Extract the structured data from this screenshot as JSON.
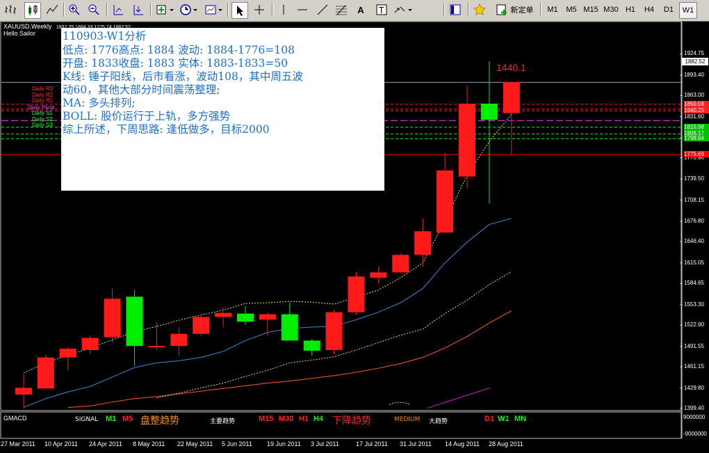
{
  "toolbar": {
    "new_order_label": "新定单",
    "timeframes": [
      "M1",
      "M5",
      "M15",
      "M30",
      "H1",
      "H4",
      "D1",
      "W1"
    ],
    "active_timeframe": "W1"
  },
  "chart_header": {
    "symbol_line": "XAUUSD,Weekly",
    "ohlc_line": "1837.25 1884.33 1775.74 1882.52",
    "subtitle": "Hello Sailor"
  },
  "note": {
    "lines": [
      "110903-W1分析",
      "低点: 1776高点: 1884  波动: 1884-1776=108",
      "开盘: 1833收盘: 1883  实体: 1883-1833=50",
      "K线: 锤子阳线，后市看涨，波动108，其中周五波",
      "动60，其他大部分时间震荡整理;",
      "MA: 多头排列;",
      "BOLL: 股价运行于上轨，多方强势",
      "综上所述，下周思路: 逢低做多，目标2000"
    ]
  },
  "pivot_labels": [
    "Daily R3",
    "Daily R2",
    "Daily R1",
    "Daily Pivot",
    "Daily S1",
    "Daily S2",
    "Daily S3"
  ],
  "price_ticks": [
    "1924.75",
    "1893.40",
    "1863.00",
    "1831.60",
    "1800.25",
    "1770.90",
    "1739.50",
    "1708.15",
    "1676.80",
    "1646.40",
    "1615.05",
    "1584.65",
    "1553.30",
    "1522.90",
    "1491.55",
    "1461.15",
    "1429.80",
    "1399.40"
  ],
  "current_price": "1882.52",
  "level_labels": [
    "1850.08",
    "1840.25",
    "1815.98",
    "1806.17",
    "1798.94",
    "1775.69"
  ],
  "chart_annotation": "1440.1",
  "sub_panel": {
    "name": "GMACD",
    "signal_label": "SIGNAL",
    "signals": [
      {
        "text": "M1",
        "color": "#00ff00"
      },
      {
        "text": "M5",
        "color": "#ff2020"
      },
      {
        "text": "盘整趋势",
        "color": "#ff8c00"
      },
      {
        "text": "主要趋势",
        "color": "#ffffff"
      },
      {
        "text": "M15",
        "color": "#ff2020"
      },
      {
        "text": "M30",
        "color": "#ff2020"
      },
      {
        "text": "H1",
        "color": "#ff2020"
      },
      {
        "text": "H4",
        "color": "#00ff00"
      },
      {
        "text": "下降趋势",
        "color": "#ff2020"
      },
      {
        "text": "MEDIUM",
        "color": "#ff8c00"
      },
      {
        "text": "大趋势",
        "color": "#ffffff"
      },
      {
        "text": "D1",
        "color": "#ff2020"
      },
      {
        "text": "W1",
        "color": "#00ff00"
      },
      {
        "text": "MN",
        "color": "#00ff00"
      }
    ],
    "scale_top": "9000000",
    "scale_bottom": "-9000000"
  },
  "date_labels": [
    "27 Mar 2011",
    "10 Apr 2011",
    "24 Apr 2011",
    "8 May 2011",
    "22 May 2011",
    "5 Jun 2011",
    "19 Jun 2011",
    "3 Jul 2011",
    "17 Jul 2011",
    "31 Jul 2011",
    "14 Aug 2011",
    "28 Aug 2011"
  ],
  "chart_data": {
    "type": "candlestick",
    "title": "XAUUSD,Weekly",
    "ylim": [
      1399.4,
      1940
    ],
    "x": [
      "27 Mar 2011",
      "3 Apr 2011",
      "10 Apr 2011",
      "17 Apr 2011",
      "24 Apr 2011",
      "1 May 2011",
      "8 May 2011",
      "15 May 2011",
      "22 May 2011",
      "29 May 2011",
      "5 Jun 2011",
      "12 Jun 2011",
      "19 Jun 2011",
      "26 Jun 2011",
      "3 Jul 2011",
      "10 Jul 2011",
      "17 Jul 2011",
      "24 Jul 2011",
      "31 Jul 2011",
      "7 Aug 2011",
      "14 Aug 2011",
      "21 Aug 2011",
      "28 Aug 2011"
    ],
    "candles": [
      {
        "o": 1420,
        "h": 1450,
        "l": 1400,
        "c": 1430
      },
      {
        "o": 1429,
        "h": 1479,
        "l": 1428,
        "c": 1475
      },
      {
        "o": 1475,
        "h": 1490,
        "l": 1456,
        "c": 1488
      },
      {
        "o": 1486,
        "h": 1508,
        "l": 1480,
        "c": 1504
      },
      {
        "o": 1505,
        "h": 1577,
        "l": 1497,
        "c": 1562
      },
      {
        "o": 1565,
        "h": 1575,
        "l": 1462,
        "c": 1492
      },
      {
        "o": 1490,
        "h": 1528,
        "l": 1486,
        "c": 1492
      },
      {
        "o": 1492,
        "h": 1520,
        "l": 1477,
        "c": 1510
      },
      {
        "o": 1510,
        "h": 1539,
        "l": 1507,
        "c": 1535
      },
      {
        "o": 1535,
        "h": 1549,
        "l": 1520,
        "c": 1541
      },
      {
        "o": 1540,
        "h": 1551,
        "l": 1523,
        "c": 1528
      },
      {
        "o": 1531,
        "h": 1542,
        "l": 1507,
        "c": 1539
      },
      {
        "o": 1539,
        "h": 1556,
        "l": 1500,
        "c": 1500
      },
      {
        "o": 1500,
        "h": 1502,
        "l": 1478,
        "c": 1485
      },
      {
        "o": 1486,
        "h": 1545,
        "l": 1480,
        "c": 1542
      },
      {
        "o": 1542,
        "h": 1602,
        "l": 1538,
        "c": 1595
      },
      {
        "o": 1593,
        "h": 1610,
        "l": 1585,
        "c": 1601
      },
      {
        "o": 1601,
        "h": 1629,
        "l": 1600,
        "c": 1627
      },
      {
        "o": 1627,
        "h": 1681,
        "l": 1609,
        "c": 1662
      },
      {
        "o": 1660,
        "h": 1778,
        "l": 1659,
        "c": 1752
      },
      {
        "o": 1743,
        "h": 1878,
        "l": 1726,
        "c": 1851
      },
      {
        "o": 1851,
        "h": 1914,
        "l": 1703,
        "c": 1827
      },
      {
        "o": 1837,
        "h": 1884,
        "l": 1776,
        "c": 1883
      }
    ],
    "ma_blue": [
      1401,
      1414,
      1424,
      1432,
      1446,
      1460,
      1467,
      1470,
      1475,
      1484,
      1500,
      1512,
      1518,
      1520,
      1521,
      1531,
      1542,
      1556,
      1577,
      1615,
      1646,
      1672,
      1681
    ],
    "boll_upper": [
      1452,
      1467,
      1478,
      1489,
      1501,
      1513,
      1521,
      1530,
      1538,
      1545,
      1555,
      1556,
      1558,
      1557,
      1554,
      1564,
      1575,
      1593,
      1615,
      1677,
      1745,
      1795,
      1835
    ],
    "boll_lower": [
      null,
      null,
      null,
      null,
      null,
      null,
      1415,
      1422,
      1430,
      1437,
      1447,
      1456,
      1467,
      1471,
      1476,
      1486,
      1497,
      1508,
      1517,
      1540,
      1560,
      1583,
      1602
    ],
    "ma_orange": [
      null,
      null,
      1401,
      1403,
      1409,
      1414,
      1417,
      1421,
      1425,
      1429,
      1433,
      1437,
      1440,
      1444,
      1448,
      1453,
      1459,
      1466,
      1475,
      1489,
      1506,
      1526,
      1544
    ],
    "levels": [
      {
        "name": "Daily R3",
        "value": 1850.1,
        "color": "#ff2020"
      },
      {
        "name": "Daily R2",
        "value": 1843,
        "color": "#ff2020"
      },
      {
        "name": "Daily R1",
        "value": 1840.3,
        "color": "#ff2020"
      },
      {
        "name": "Daily Pivot",
        "value": 1825.9,
        "color": "#ff40ff"
      },
      {
        "name": "Daily S1",
        "value": 1816,
        "color": "#00ff00"
      },
      {
        "name": "Daily S2",
        "value": 1806.2,
        "color": "#00ff00"
      },
      {
        "name": "Daily S3",
        "value": 1798.9,
        "color": "#00ff00"
      },
      {
        "name": "",
        "value": 1775.7,
        "color": "#ff0000"
      }
    ],
    "colors": {
      "up": "#ff1a1a",
      "down": "#00ee00",
      "ma_blue": "#2f8fd6",
      "boll": "#e8e84a",
      "ma_orange": "#ff5a28"
    }
  }
}
